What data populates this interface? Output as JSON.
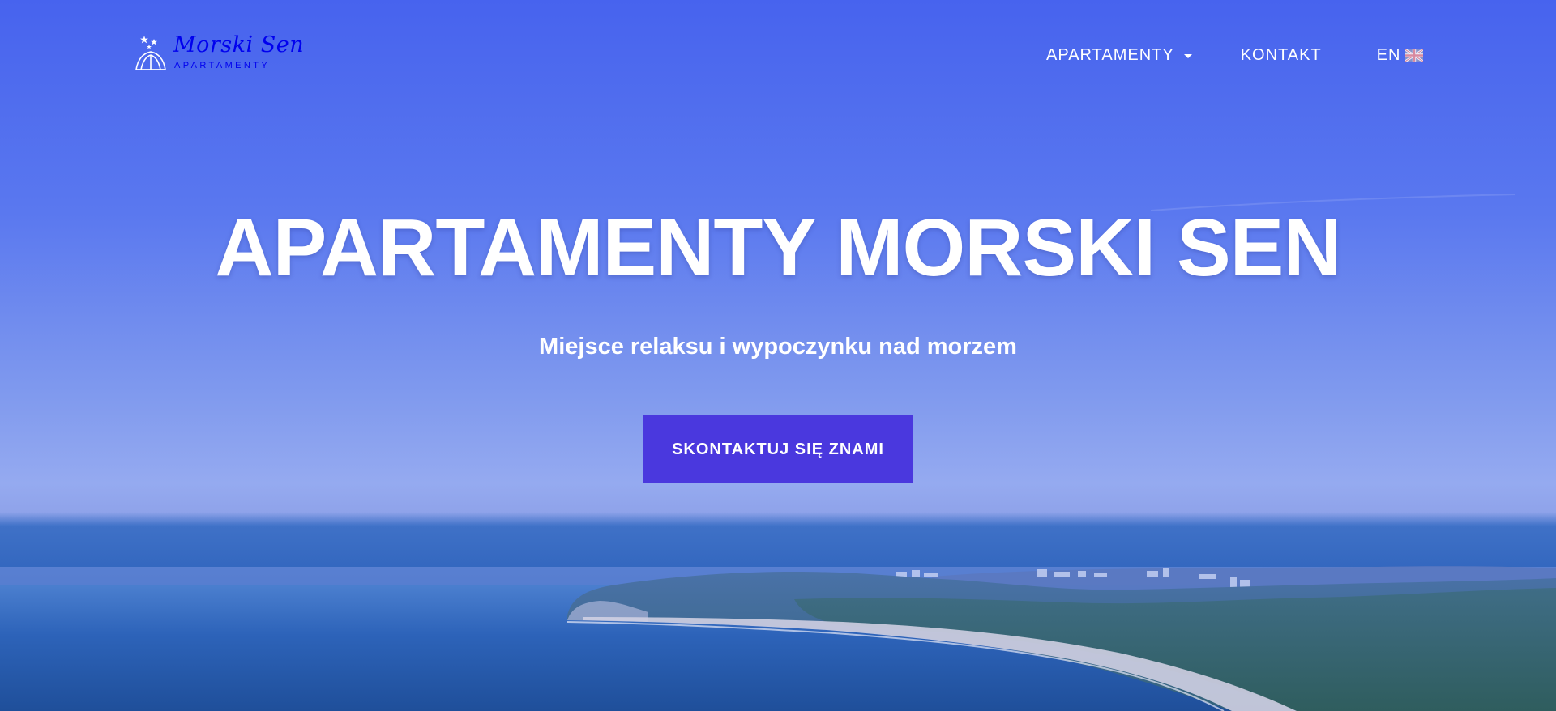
{
  "brand": {
    "logo_script": "Morski Sen",
    "logo_sub": "APARTAMENTY",
    "logo_icon": "shell-stars-icon"
  },
  "nav": {
    "items": [
      {
        "label": "APARTAMENTY",
        "has_dropdown": true
      },
      {
        "label": "KONTAKT",
        "has_dropdown": false
      },
      {
        "label": "EN",
        "icon": "uk-flag-icon"
      }
    ]
  },
  "hero": {
    "title": "APARTAMENTY MORSKI SEN",
    "subtitle": "Miejsce relaksu i wypoczynku nad morzem",
    "cta_label": "SKONTAKTUJ SIĘ ZNAMI"
  },
  "colors": {
    "overlay_blue": "#4763ee",
    "cta_background": "#4a38de",
    "text": "#ffffff",
    "sea": "#2a5fb8",
    "forest": "#3a6f78",
    "beach": "#c9c6d8"
  }
}
